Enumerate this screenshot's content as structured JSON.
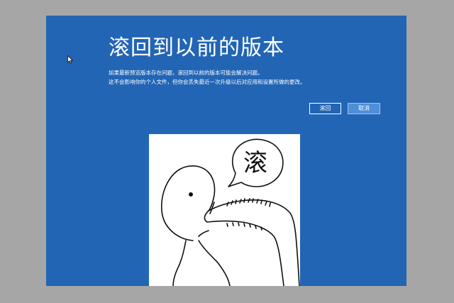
{
  "dialog": {
    "title": "滚回到以前的版本",
    "description_line1": "如果最新预览版本存在问题，滚回到以前的版本可能会解决问题。",
    "description_line2": "这不会影响你的个人文件，但你会丢失最近一次升级以后对应用和设置所做的更改。",
    "rollback_button": "滚回",
    "cancel_button": "取消"
  },
  "illustration": {
    "bubble_text": "滚"
  },
  "colors": {
    "desktop_gray": "#a6a6a6",
    "dialog_blue": "#2265b5",
    "cancel_button_bg": "#4e8fd8"
  },
  "icons": {
    "cursor": "mouse-pointer-icon"
  }
}
